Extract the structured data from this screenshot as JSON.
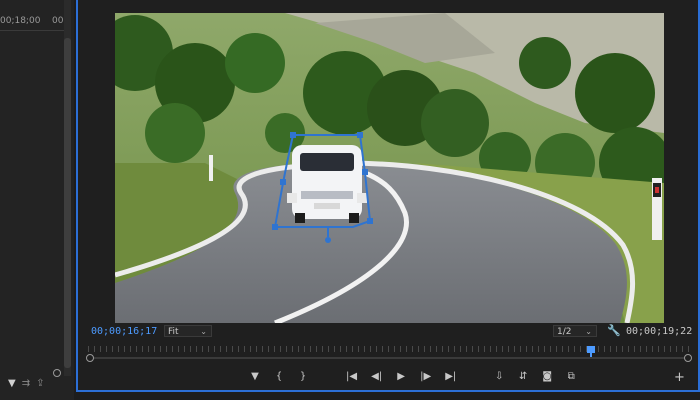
{
  "left_panel": {
    "timecode": "00;18;00",
    "timecode_partial": "00",
    "tools": [
      "▼",
      "⇉",
      "⇪"
    ]
  },
  "viewer": {
    "current_timecode": "00;00;16;17",
    "zoom": "Fit",
    "resolution": "1/2",
    "duration": "00;00;19;22",
    "playhead_fraction": 0.84
  },
  "controls": {
    "marker": "▼",
    "in_point": "{",
    "out_point": "}",
    "go_to_in": "|◀",
    "step_back": "◀|",
    "play": "▶",
    "step_forward": "|▶",
    "go_to_out": "▶|",
    "insert": "⇩",
    "overwrite": "⇵",
    "export_frame": "◙",
    "compare": "⧉",
    "add": "+"
  },
  "colors": {
    "accent": "#2c6fd6",
    "timecode": "#4d9bff",
    "mask": "#2f74d0"
  }
}
